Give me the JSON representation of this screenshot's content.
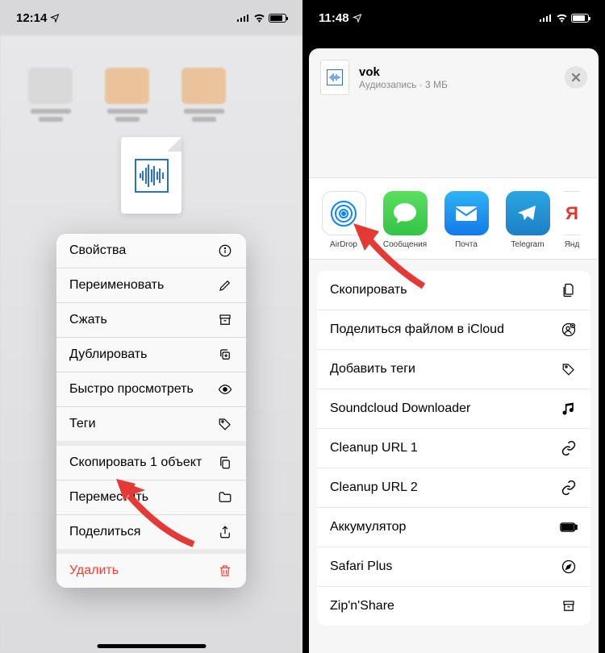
{
  "left": {
    "time": "12:14",
    "contextMenu": [
      {
        "label": "Свойства",
        "icon": "info"
      },
      {
        "label": "Переименовать",
        "icon": "pencil"
      },
      {
        "label": "Сжать",
        "icon": "archive"
      },
      {
        "label": "Дублировать",
        "icon": "duplicate"
      },
      {
        "label": "Быстро просмотреть",
        "icon": "eye"
      },
      {
        "label": "Теги",
        "icon": "tag",
        "sectionEnd": true
      },
      {
        "label": "Скопировать 1 объект",
        "icon": "copy"
      },
      {
        "label": "Переместить",
        "icon": "folder"
      },
      {
        "label": "Поделиться",
        "icon": "share",
        "sectionEnd": true
      },
      {
        "label": "Удалить",
        "icon": "trash",
        "danger": true
      }
    ]
  },
  "right": {
    "time": "11:48",
    "file": {
      "name": "vok",
      "subtitle": "Аудиозапись · 3 МБ"
    },
    "apps": [
      {
        "label": "AirDrop",
        "type": "airdrop"
      },
      {
        "label": "Сообщения",
        "type": "messages"
      },
      {
        "label": "Почта",
        "type": "mail"
      },
      {
        "label": "Telegram",
        "type": "telegram"
      },
      {
        "label": "Янд",
        "type": "yandex",
        "partial": true
      }
    ],
    "actions": [
      {
        "label": "Скопировать",
        "icon": "copy-docs"
      },
      {
        "label": "Поделиться файлом в iCloud",
        "icon": "person-plus"
      },
      {
        "label": "Добавить теги",
        "icon": "tag"
      },
      {
        "label": "Soundcloud Downloader",
        "icon": "music"
      },
      {
        "label": "Cleanup URL 1",
        "icon": "link"
      },
      {
        "label": "Cleanup URL 2",
        "icon": "link"
      },
      {
        "label": "Аккумулятор",
        "icon": "battery"
      },
      {
        "label": "Safari Plus",
        "icon": "compass"
      },
      {
        "label": "Zip'n'Share",
        "icon": "archive"
      }
    ]
  }
}
